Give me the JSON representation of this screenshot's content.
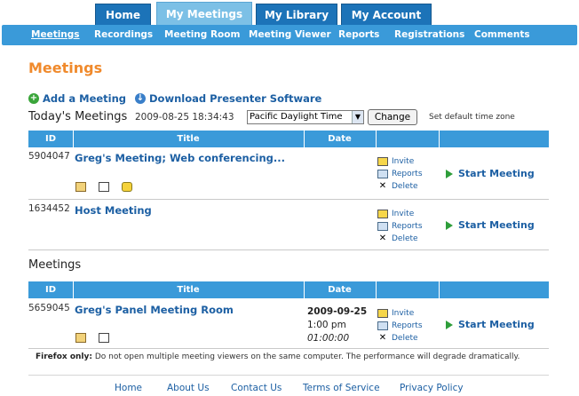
{
  "tabs": [
    {
      "label": "Home",
      "active": false
    },
    {
      "label": "My Meetings",
      "active": true
    },
    {
      "label": "My Library",
      "active": false
    },
    {
      "label": "My Account",
      "active": false
    }
  ],
  "subnav": [
    "Meetings",
    "Recordings",
    "Meeting Room",
    "Meeting Viewer",
    "Reports",
    "Registrations",
    "Comments"
  ],
  "page_title": "Meetings",
  "actions": {
    "add_meeting": "Add a Meeting",
    "download": "Download Presenter Software"
  },
  "today": {
    "label": "Today's Meetings",
    "datetime": "2009-08-25 18:34:43",
    "timezone": "Pacific Daylight Time",
    "change_label": "Change",
    "tz_note": "Set default time zone"
  },
  "table_headers": {
    "id": "ID",
    "title": "Title",
    "date": "Date"
  },
  "today_meetings": [
    {
      "id": "5904047",
      "title": "Greg's Meeting; Web conferencing..."
    },
    {
      "id": "1634452",
      "title": "Host Meeting"
    }
  ],
  "section_meetings": {
    "label": "Meetings",
    "rows": [
      {
        "id": "5659045",
        "title": "Greg's Panel Meeting Room",
        "date": "2009-09-25",
        "time": "1:00 pm",
        "duration": "01:00:00"
      }
    ]
  },
  "ops": {
    "invite": "Invite",
    "reports": "Reports",
    "delete": "Delete",
    "start": "Start Meeting"
  },
  "firefox_note": {
    "bold": "Firefox only:",
    "text": " Do not open multiple meeting viewers on the same computer. The performance will degrade dramatically."
  },
  "footer": [
    "Home",
    "About Us",
    "Contact Us",
    "Terms of Service",
    "Privacy Policy"
  ],
  "colors": {
    "tab_blue": "#1c73b8",
    "active_tab": "#7cc0e6",
    "subnav_blue": "#3a9ad9",
    "title_orange": "#f08a2c",
    "link_blue": "#1c5fa3"
  }
}
